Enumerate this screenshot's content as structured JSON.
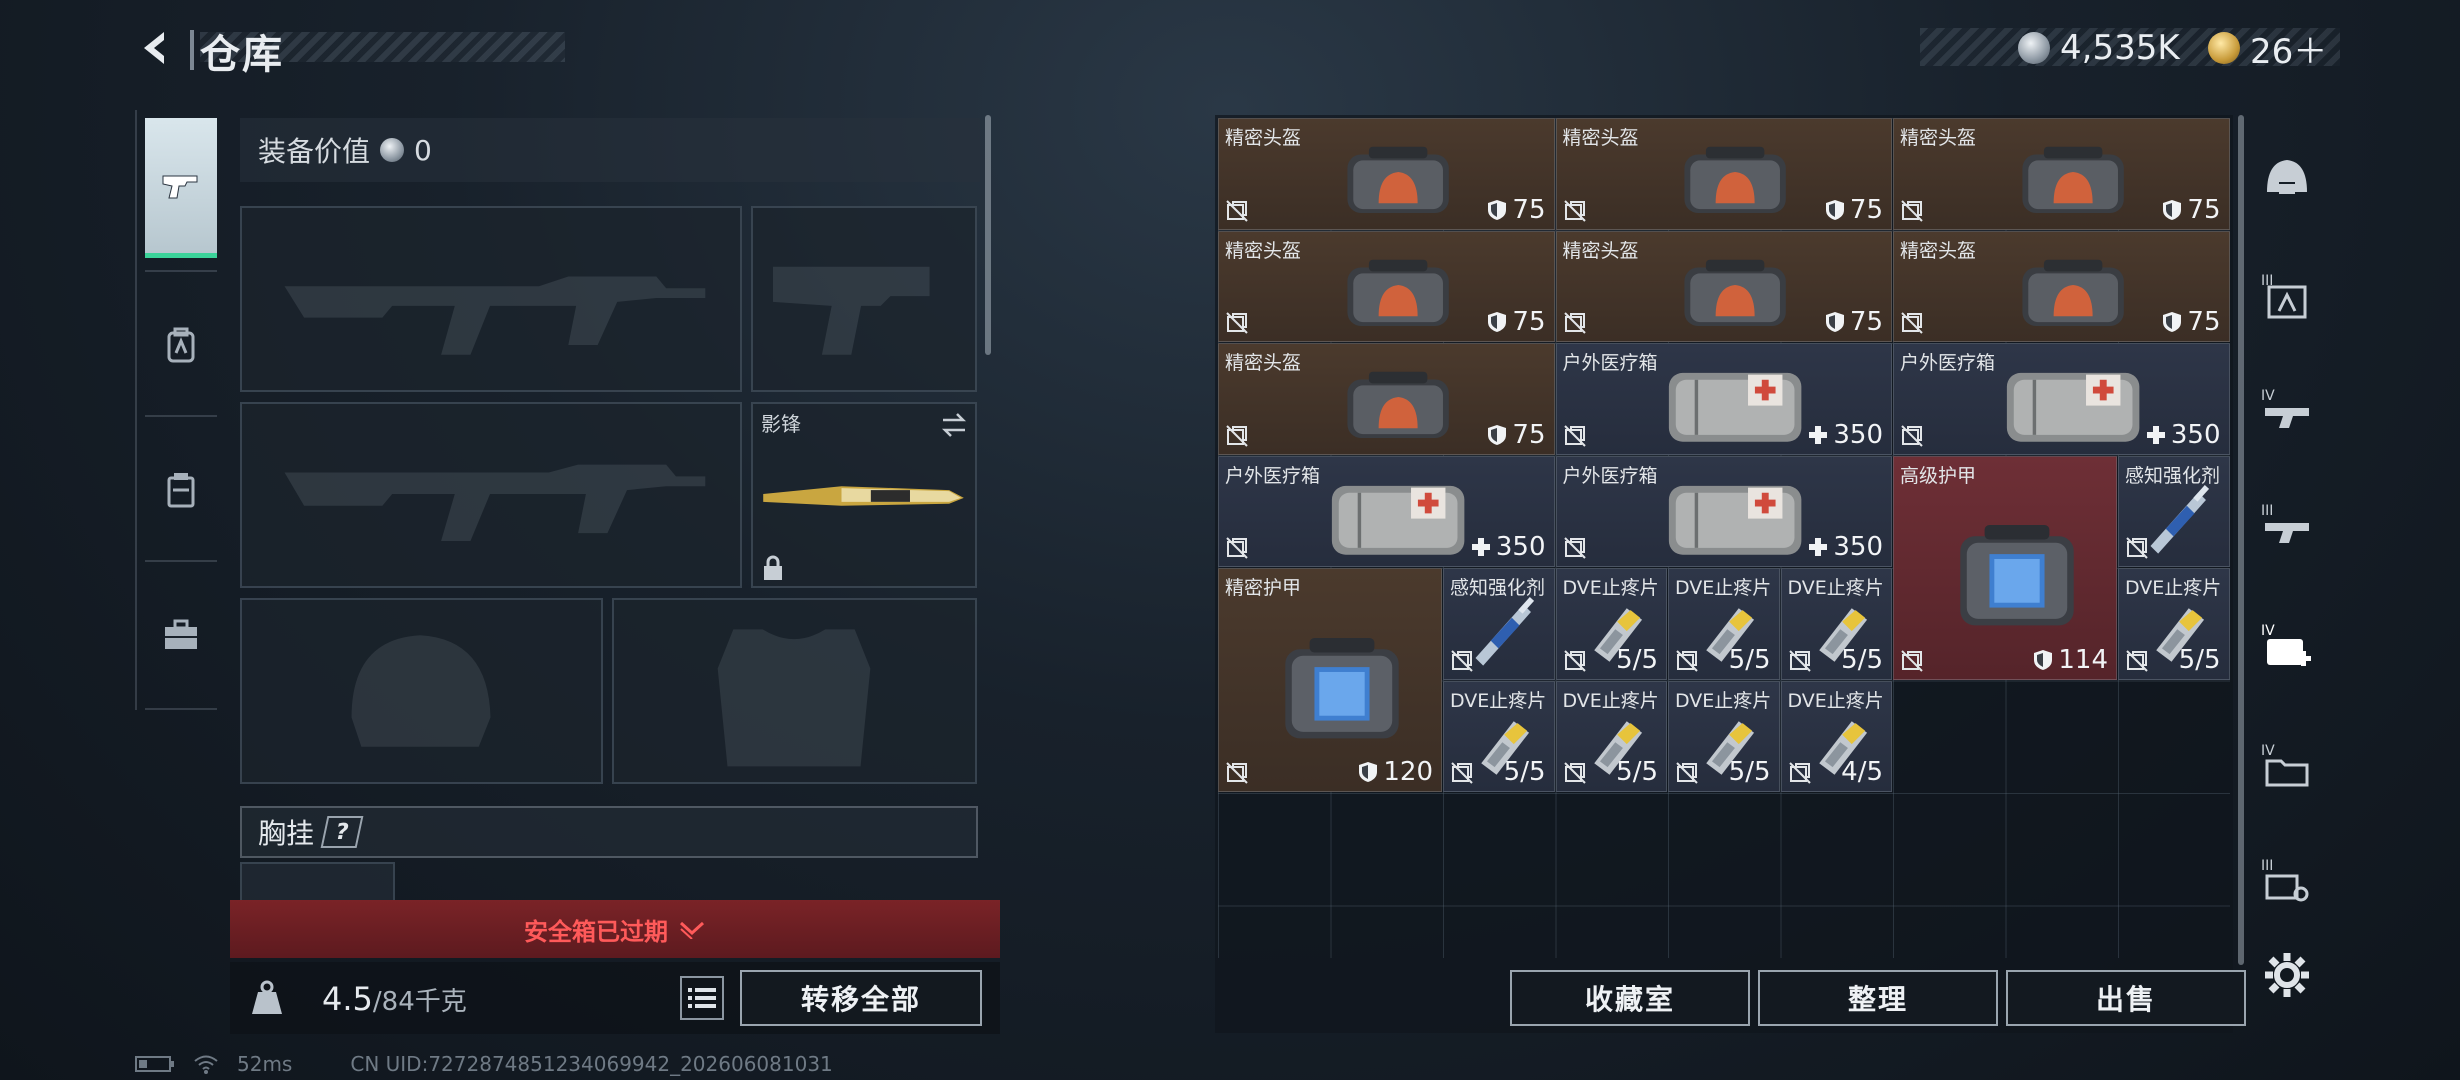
{
  "header": {
    "title": "仓库",
    "currencies": [
      {
        "icon": "silver-coin-icon",
        "value": "4,535K"
      },
      {
        "icon": "gold-coin-icon",
        "value": "26＋"
      }
    ]
  },
  "left_tabs": [
    {
      "icon": "pistol-icon",
      "active": true
    },
    {
      "icon": "backpack-icon",
      "active": false
    },
    {
      "icon": "chest-rig-icon",
      "active": false
    },
    {
      "icon": "toolbox-icon",
      "active": false
    }
  ],
  "loadout": {
    "equip_value_label": "装备价值",
    "equip_value": "0",
    "melee_name": "影锋",
    "chest_label": "胸挂",
    "safebox_text": "安全箱已过期",
    "weight_value": "4.5",
    "weight_max": "/84千克",
    "transfer_all": "转移全部"
  },
  "storage": {
    "items": [
      {
        "name": "精密头盔",
        "value": "75",
        "kind": "helmet",
        "color": "brown"
      },
      {
        "name": "精密头盔",
        "value": "75",
        "kind": "helmet",
        "color": "brown"
      },
      {
        "name": "精密头盔",
        "value": "75",
        "kind": "helmet",
        "color": "brown"
      },
      {
        "name": "精密头盔",
        "value": "75",
        "kind": "helmet",
        "color": "brown"
      },
      {
        "name": "精密头盔",
        "value": "75",
        "kind": "helmet",
        "color": "brown"
      },
      {
        "name": "精密头盔",
        "value": "75",
        "kind": "helmet",
        "color": "brown"
      },
      {
        "name": "精密头盔",
        "value": "75",
        "kind": "helmet",
        "color": "brown"
      },
      {
        "name": "户外医疗箱",
        "value": "350",
        "kind": "medkit",
        "color": "blue"
      },
      {
        "name": "户外医疗箱",
        "value": "350",
        "kind": "medkit",
        "color": "blue"
      },
      {
        "name": "户外医疗箱",
        "value": "350",
        "kind": "medkit",
        "color": "blue"
      },
      {
        "name": "户外医疗箱",
        "value": "350",
        "kind": "medkit",
        "color": "blue"
      },
      {
        "name": "高级护甲",
        "value": "114",
        "kind": "armor",
        "color": "red"
      },
      {
        "name": "感知强化剂",
        "value": "",
        "kind": "injector",
        "color": "blue"
      },
      {
        "name": "精密护甲",
        "value": "120",
        "kind": "armor",
        "color": "brown"
      },
      {
        "name": "感知强化剂",
        "value": "",
        "kind": "injector",
        "color": "blue"
      },
      {
        "name": "DVE止疼片",
        "value": "5/5",
        "kind": "pills",
        "color": "blue"
      },
      {
        "name": "DVE止疼片",
        "value": "5/5",
        "kind": "pills",
        "color": "blue"
      },
      {
        "name": "DVE止疼片",
        "value": "5/5",
        "kind": "pills",
        "color": "blue"
      },
      {
        "name": "DVE止疼片",
        "value": "5/5",
        "kind": "pills",
        "color": "blue"
      },
      {
        "name": "DVE止疼片",
        "value": "5/5",
        "kind": "pills",
        "color": "blue"
      },
      {
        "name": "DVE止疼片",
        "value": "5/5",
        "kind": "pills",
        "color": "blue"
      },
      {
        "name": "DVE止疼片",
        "value": "5/5",
        "kind": "pills",
        "color": "blue"
      },
      {
        "name": "DVE止疼片",
        "value": "4/5",
        "kind": "pills",
        "color": "blue"
      }
    ],
    "buttons": {
      "collection": "收藏室",
      "sort": "整理",
      "sell": "出售"
    }
  },
  "rail": [
    {
      "icon": "helmet-category-icon"
    },
    {
      "icon": "tier3-armor-icon"
    },
    {
      "icon": "tier4-weapon-icon"
    },
    {
      "icon": "tier3-weapon-icon"
    },
    {
      "icon": "tier4-medical-icon"
    },
    {
      "icon": "tier4-folder-icon"
    },
    {
      "icon": "tier3-tool-icon"
    },
    {
      "icon": "settings-gear-icon"
    }
  ],
  "status": {
    "ping": "52ms",
    "uid": "CN UID:7272874851234069942_202606081031"
  },
  "colors": {
    "accent_green": "#3bd39a",
    "alert_red": "#ff5a5a",
    "brown_item": "#4b3a2d",
    "blue_item": "#2e3648",
    "red_item": "#6e2f36"
  }
}
